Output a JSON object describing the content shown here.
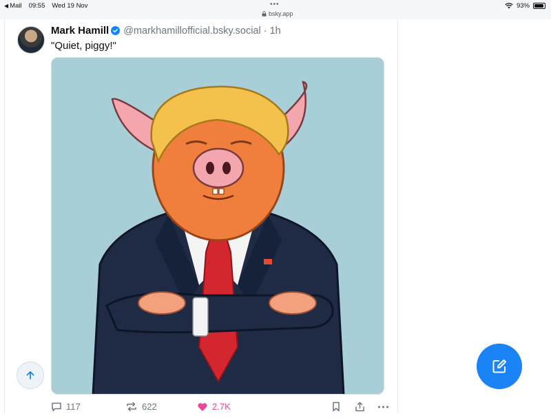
{
  "status_bar": {
    "back_app": "Mail",
    "time": "09:55",
    "date": "Wed 19 Nov",
    "url": "bsky.app",
    "battery": "93%",
    "battery_level": 0.93
  },
  "post": {
    "author": "Mark Hamill",
    "handle": "@markhamillofficial.bsky.social · 1h",
    "text": "\"Quiet, piggy!\"",
    "stats": {
      "replies": "117",
      "reposts": "622",
      "likes": "2.7K"
    }
  },
  "colors": {
    "accent": "#1a83f6",
    "like": "#ec4899",
    "verified": "#1185fe",
    "muted": "#6b7682"
  },
  "icons": {
    "back": "back-arrow-icon",
    "wifi": "wifi-icon",
    "lock": "lock-icon",
    "verified": "verified-check-icon",
    "reply": "reply-icon",
    "repost": "repost-icon",
    "like": "heart-icon",
    "bookmark": "bookmark-icon",
    "share": "share-icon",
    "more": "more-icon",
    "scroll_top": "arrow-up-icon",
    "compose": "compose-icon"
  }
}
